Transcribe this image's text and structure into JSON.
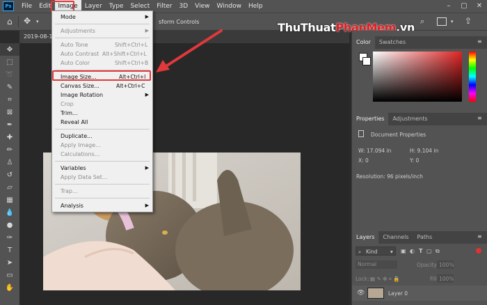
{
  "menubar": {
    "items": [
      "File",
      "Edit",
      "Image",
      "Layer",
      "Type",
      "Select",
      "Filter",
      "3D",
      "View",
      "Window",
      "Help"
    ],
    "logo": "Ps"
  },
  "options_bar": {
    "partial_label": "sform Controls"
  },
  "document_tab": "2019-08-16",
  "watermark": {
    "part1": "ThuThuat",
    "part2": "PhanMem",
    "part3": ".vn"
  },
  "image_menu": {
    "items": [
      {
        "label": "Mode",
        "shortcut": "",
        "submenu": true,
        "disabled": false
      },
      {
        "label": "Adjustments",
        "shortcut": "",
        "submenu": true,
        "disabled": true
      },
      {
        "label": "Auto Tone",
        "shortcut": "Shift+Ctrl+L",
        "submenu": false,
        "disabled": true
      },
      {
        "label": "Auto Contrast",
        "shortcut": "Alt+Shift+Ctrl+L",
        "submenu": false,
        "disabled": true
      },
      {
        "label": "Auto Color",
        "shortcut": "Shift+Ctrl+B",
        "submenu": false,
        "disabled": true
      },
      {
        "label": "Image Size...",
        "shortcut": "Alt+Ctrl+I",
        "submenu": false,
        "disabled": false
      },
      {
        "label": "Canvas Size...",
        "shortcut": "Alt+Ctrl+C",
        "submenu": false,
        "disabled": false
      },
      {
        "label": "Image Rotation",
        "shortcut": "",
        "submenu": true,
        "disabled": false
      },
      {
        "label": "Crop",
        "shortcut": "",
        "submenu": false,
        "disabled": true
      },
      {
        "label": "Trim...",
        "shortcut": "",
        "submenu": false,
        "disabled": false
      },
      {
        "label": "Reveal All",
        "shortcut": "",
        "submenu": false,
        "disabled": false
      },
      {
        "label": "Duplicate...",
        "shortcut": "",
        "submenu": false,
        "disabled": false
      },
      {
        "label": "Apply Image...",
        "shortcut": "",
        "submenu": false,
        "disabled": true
      },
      {
        "label": "Calculations...",
        "shortcut": "",
        "submenu": false,
        "disabled": true
      },
      {
        "label": "Variables",
        "shortcut": "",
        "submenu": true,
        "disabled": false
      },
      {
        "label": "Apply Data Set...",
        "shortcut": "",
        "submenu": false,
        "disabled": true
      },
      {
        "label": "Trap...",
        "shortcut": "",
        "submenu": false,
        "disabled": true
      },
      {
        "label": "Analysis",
        "shortcut": "",
        "submenu": true,
        "disabled": false
      }
    ]
  },
  "color_panel": {
    "tabs": [
      "Color",
      "Swatches"
    ]
  },
  "properties_panel": {
    "tabs": [
      "Properties",
      "Adjustments"
    ],
    "title": "Document Properties",
    "w": "W:  17.094 in",
    "h": "H:  9.104 in",
    "x": "X:  0",
    "y": "Y:  0",
    "resolution": "Resolution:  96 pixels/inch"
  },
  "layers_panel": {
    "tabs": [
      "Layers",
      "Channels",
      "Paths"
    ],
    "kind": "Kind",
    "blend_mode": "Normal",
    "opacity_label": "Opacity:",
    "opacity_value": "100%",
    "lock_label": "Lock:",
    "fill_label": "Fill:",
    "fill_value": "100%",
    "layer_name": "Layer 0"
  },
  "colors": {
    "accent_red": "#e0393b",
    "menubar": "#535353",
    "canvas": "#282828"
  }
}
